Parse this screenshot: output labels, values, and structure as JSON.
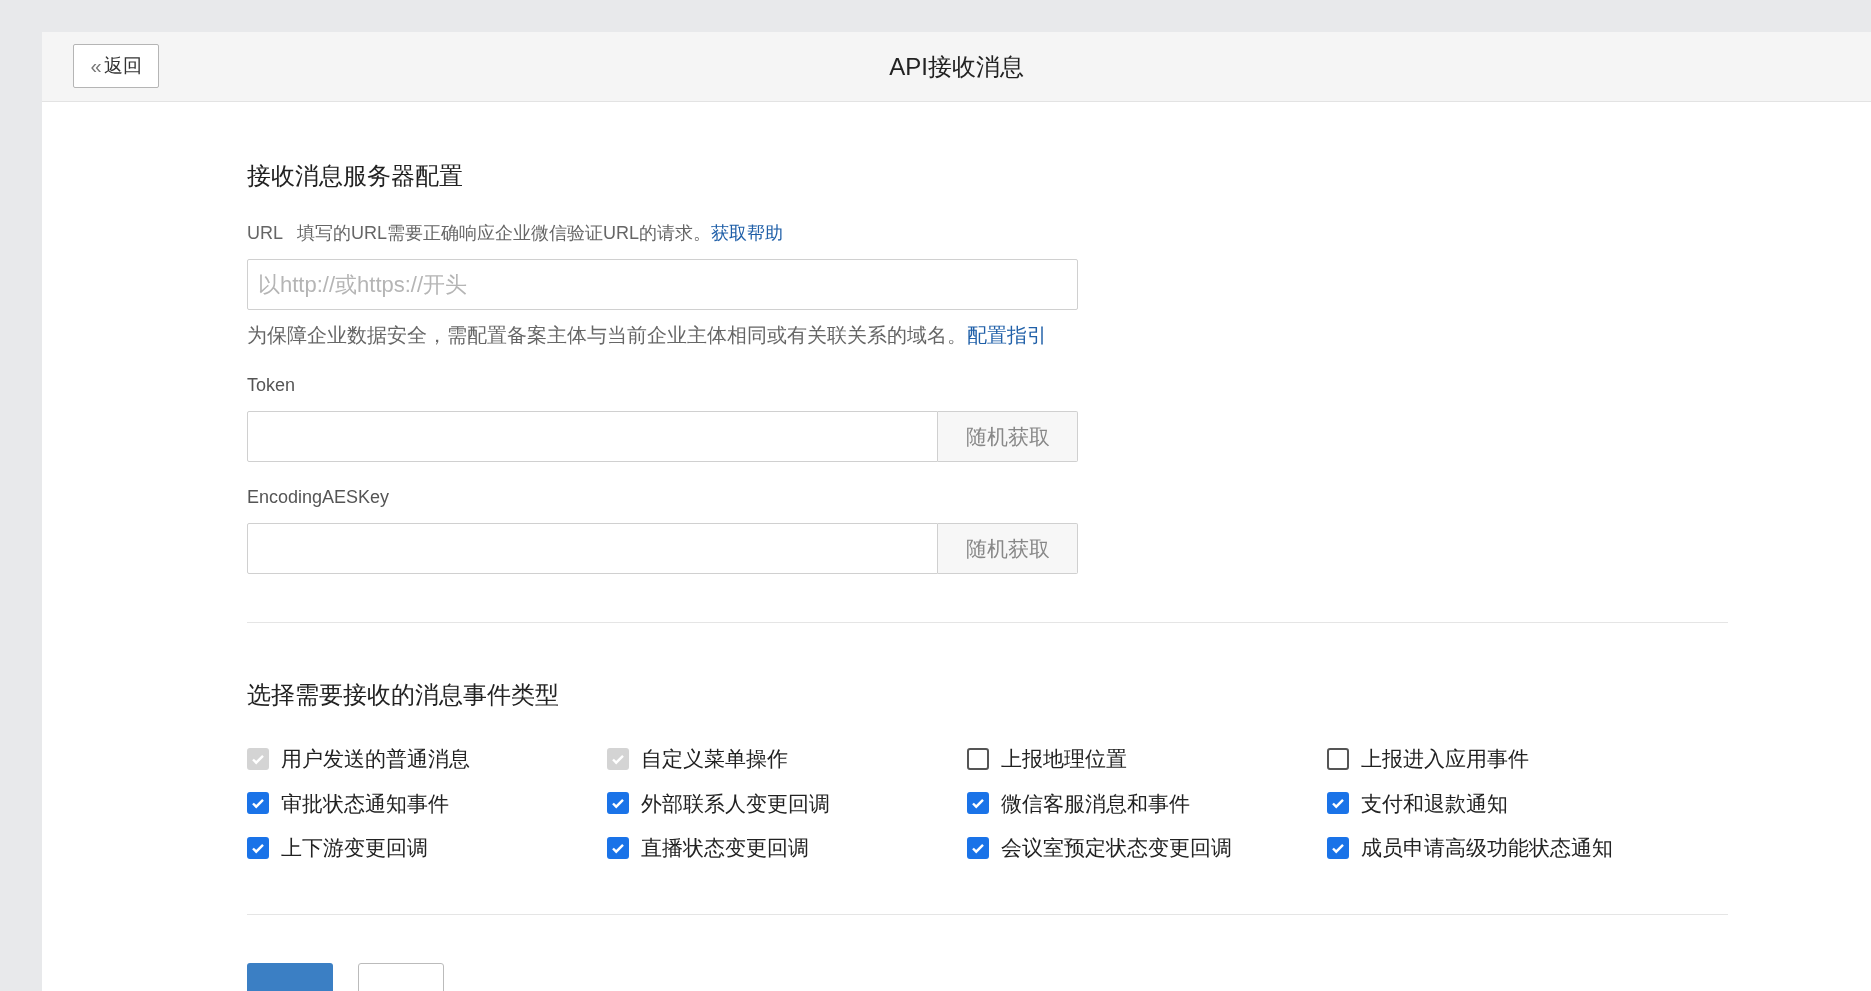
{
  "header": {
    "back_button": {
      "icon": "«",
      "label": "返回"
    },
    "title": "API接收消息"
  },
  "server_config": {
    "title": "接收消息服务器配置",
    "url": {
      "label": "URL",
      "hint": "填写的URL需要正确响应企业微信验证URL的请求。",
      "help_link": "获取帮助",
      "placeholder": "以http://或https://开头",
      "note": "为保障企业数据安全，需配置备案主体与当前企业主体相同或有关联关系的域名。",
      "note_link": "配置指引"
    },
    "token": {
      "label": "Token",
      "button": "随机获取"
    },
    "aes_key": {
      "label": "EncodingAESKey",
      "button": "随机获取"
    }
  },
  "event_types": {
    "title": "选择需要接收的消息事件类型",
    "items": [
      {
        "label": "用户发送的普通消息",
        "checked": true,
        "disabled": true
      },
      {
        "label": "自定义菜单操作",
        "checked": true,
        "disabled": true
      },
      {
        "label": "上报地理位置",
        "checked": false,
        "disabled": false
      },
      {
        "label": "上报进入应用事件",
        "checked": false,
        "disabled": false
      },
      {
        "label": "审批状态通知事件",
        "checked": true,
        "disabled": false
      },
      {
        "label": "外部联系人变更回调",
        "checked": true,
        "disabled": false
      },
      {
        "label": "微信客服消息和事件",
        "checked": true,
        "disabled": false
      },
      {
        "label": "支付和退款通知",
        "checked": true,
        "disabled": false
      },
      {
        "label": "上下游变更回调",
        "checked": true,
        "disabled": false
      },
      {
        "label": "直播状态变更回调",
        "checked": true,
        "disabled": false
      },
      {
        "label": "会议室预定状态变更回调",
        "checked": true,
        "disabled": false
      },
      {
        "label": "成员申请高级功能状态通知",
        "checked": true,
        "disabled": false
      }
    ]
  }
}
